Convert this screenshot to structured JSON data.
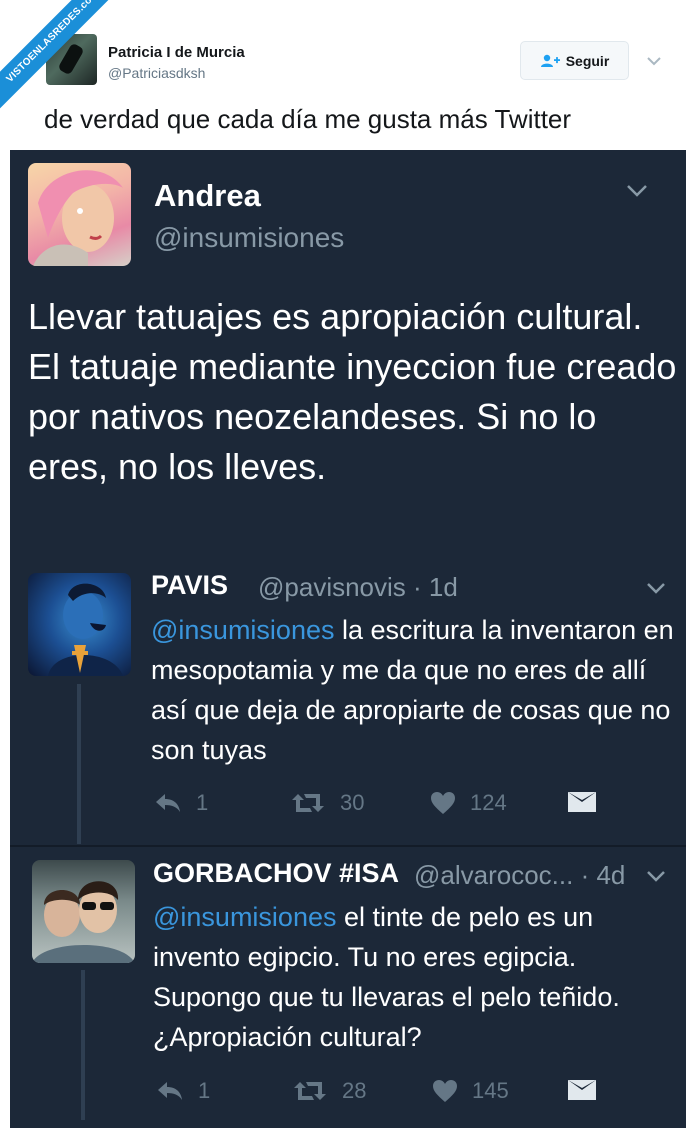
{
  "watermark": "VISTOENLASREDES.com",
  "outer_tweet": {
    "name": "Patricia I de Murcia",
    "handle": "@Patriciasdksh",
    "follow_label": "Seguir",
    "text": "de verdad que cada día me gusta más Twitter"
  },
  "original": {
    "name": "Andrea",
    "handle": "@insumisiones",
    "text": "Llevar tatuajes es apropiación cultural. El tatuaje mediante inyeccion fue creado por nativos neozelandeses. Si no lo eres, no los lleves."
  },
  "replies": [
    {
      "name": "PAVIS",
      "meta": "@pavisnovis · 1d",
      "mention": "@insumisiones",
      "text": " la escritura la inventaron en mesopotamia y me da que no eres de allí así que deja de apropiarte de cosas que no son tuyas",
      "replies": "1",
      "retweets": "30",
      "likes": "124"
    },
    {
      "name": "GORBACHOV #ISA",
      "meta": "@alvarococ... · 4d",
      "mention": "@insumisiones",
      "text": " el tinte de pelo es un invento egipcio. Tu no eres egipcia. Supongo que tu llevaras el pelo teñido. ¿Apropiación cultural?",
      "replies": "1",
      "retweets": "28",
      "likes": "145"
    }
  ],
  "colors": {
    "dark_bg": "#1c2838",
    "mention": "#3a96dd",
    "muted": "#8899a6",
    "watermark": "#1b8fd8"
  }
}
